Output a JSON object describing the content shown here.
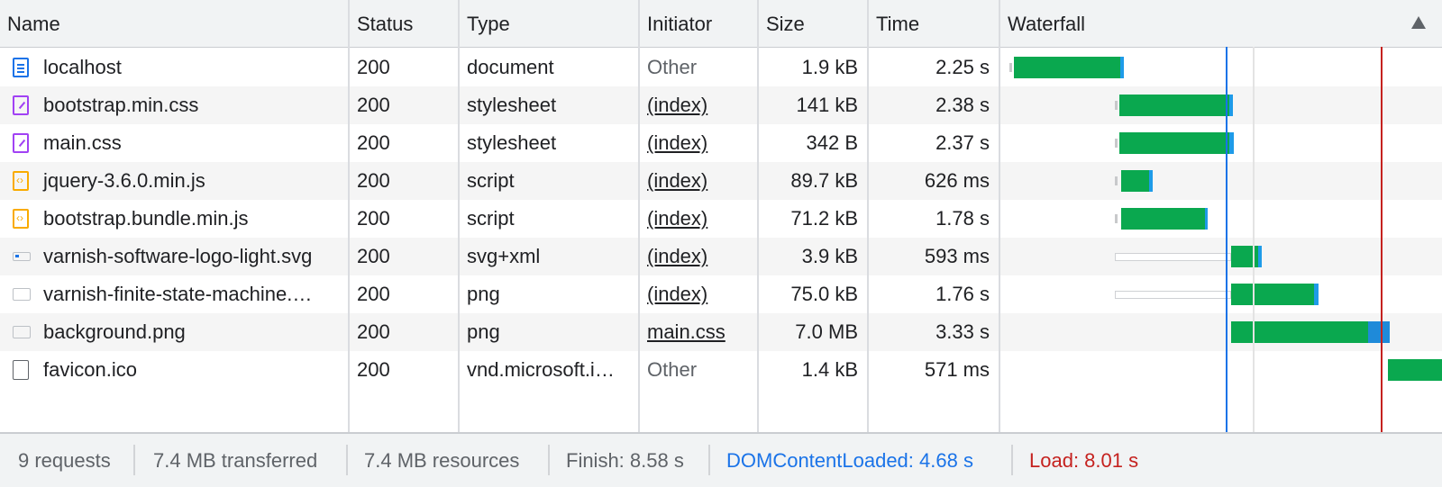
{
  "columns": {
    "name": "Name",
    "status": "Status",
    "type": "Type",
    "initiator": "Initiator",
    "size": "Size",
    "time": "Time",
    "waterfall": "Waterfall"
  },
  "requests": [
    {
      "name": "localhost",
      "status": "200",
      "type": "document",
      "initiator": "Other",
      "initiator_kind": "other",
      "size": "1.9 kB",
      "time": "2.25 s",
      "icon": "document-icon"
    },
    {
      "name": "bootstrap.min.css",
      "status": "200",
      "type": "stylesheet",
      "initiator": "(index)",
      "initiator_kind": "link",
      "size": "141 kB",
      "time": "2.38 s",
      "icon": "stylesheet-icon"
    },
    {
      "name": "main.css",
      "status": "200",
      "type": "stylesheet",
      "initiator": "(index)",
      "initiator_kind": "link",
      "size": "342 B",
      "time": "2.37 s",
      "icon": "stylesheet-icon"
    },
    {
      "name": "jquery-3.6.0.min.js",
      "status": "200",
      "type": "script",
      "initiator": "(index)",
      "initiator_kind": "link",
      "size": "89.7 kB",
      "time": "626 ms",
      "icon": "script-icon"
    },
    {
      "name": "bootstrap.bundle.min.js",
      "status": "200",
      "type": "script",
      "initiator": "(index)",
      "initiator_kind": "link",
      "size": "71.2 kB",
      "time": "1.78 s",
      "icon": "script-icon"
    },
    {
      "name": "varnish-software-logo-light.svg",
      "status": "200",
      "type": "svg+xml",
      "initiator": "(index)",
      "initiator_kind": "link",
      "size": "3.9 kB",
      "time": "593 ms",
      "icon": "svg-image-icon"
    },
    {
      "name": "varnish-finite-state-machine.…",
      "status": "200",
      "type": "png",
      "initiator": "(index)",
      "initiator_kind": "link",
      "size": "75.0 kB",
      "time": "1.76 s",
      "icon": "image-icon"
    },
    {
      "name": "background.png",
      "status": "200",
      "type": "png",
      "initiator": "main.css",
      "initiator_kind": "link",
      "size": "7.0 MB",
      "time": "3.33 s",
      "icon": "image-icon"
    },
    {
      "name": "favicon.ico",
      "status": "200",
      "type": "vnd.microsoft.i…",
      "initiator": "Other",
      "initiator_kind": "other",
      "size": "1.4 kB",
      "time": "571 ms",
      "icon": "file-icon"
    }
  ],
  "footer": {
    "requests": "9 requests",
    "transferred": "7.4 MB transferred",
    "resources": "7.4 MB resources",
    "finish": "Finish: 8.58 s",
    "dom_content_loaded": "DOMContentLoaded: 4.68 s",
    "load": "Load: 8.01 s"
  },
  "colors": {
    "download": "#0aa84f",
    "waiting_end": "#1e9be8",
    "dom_content_loaded_line": "#1a73e8",
    "load_line": "#c5221f",
    "dom_content_loaded_text": "#1a73e8",
    "load_text": "#c5221f"
  }
}
